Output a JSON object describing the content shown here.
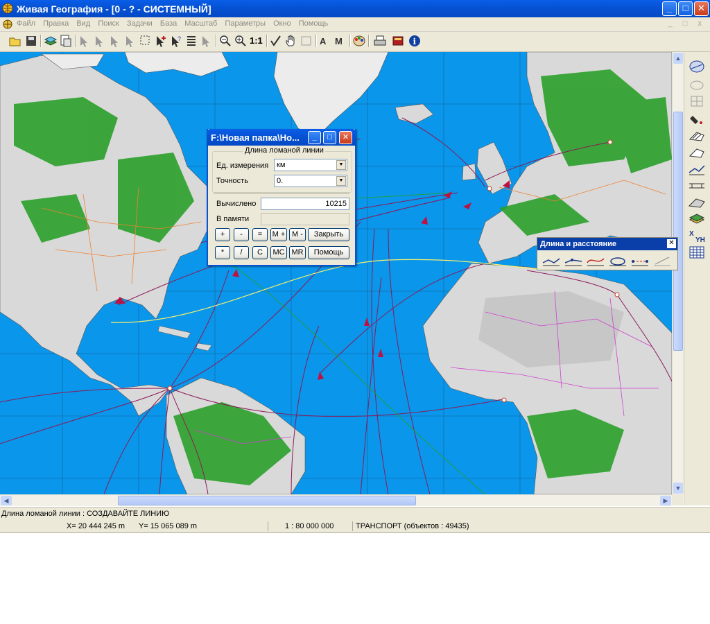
{
  "window": {
    "title": "Живая География - [0 -  ?  - СИСТЕМНЫЙ]",
    "minimize": "_",
    "maximize": "□",
    "close": "✕"
  },
  "menu": {
    "items": [
      "Файл",
      "Правка",
      "Вид",
      "Поиск",
      "Задачи",
      "База",
      "Масштаб",
      "Параметры",
      "Окно",
      "Помощь"
    ],
    "mdi_controls": "_ □ x"
  },
  "toolbar": {
    "zoom_ratio_label": "1:1",
    "icons": [
      "open-icon",
      "save-icon",
      "layers-icon",
      "print-preview-icon",
      "select-arrow-icon",
      "select-rect-icon",
      "list-icon",
      "zoom-out-icon",
      "zoom-in-icon",
      "pan-hand-icon",
      "text-icon",
      "palette-icon",
      "printer-icon",
      "book-icon",
      "info-icon"
    ]
  },
  "calculator_dialog": {
    "title": "F:\\Новая папка\\Но...",
    "group_title": "Длина ломаной линии",
    "units_label": "Ед. измерения",
    "units_value": "км",
    "precision_label": "Точность",
    "precision_value": "0.",
    "computed_label": "Вычислено",
    "computed_value": "10215",
    "memory_label": "В памяти",
    "memory_value": "",
    "buttons": {
      "plus": "+",
      "minus": "-",
      "equals": "=",
      "mplus": "M +",
      "mminus": "M -",
      "close": "Закрыть",
      "multiply": "*",
      "divide": "/",
      "clear": "C",
      "mc": "MC",
      "mr": "MR",
      "help": "Помощь"
    }
  },
  "length_palette": {
    "title": "Длина и расстояние",
    "close": "✕"
  },
  "status": {
    "message": "Длина ломаной линии : СОЗДАВАЙТЕ ЛИНИЮ",
    "x_coord": "X=  20 444 245 m",
    "y_coord": "Y=  15 065 089 m",
    "scale": "1 : 80 000 000",
    "layer_info": "ТРАНСПОРТ   (объектов : 49435)"
  },
  "colors": {
    "ocean": "#0a96ea",
    "land": "#d9d9d9",
    "vegetation": "#2aa02a",
    "title_bar": "#0653d6",
    "route_lines": "#8a1a5a"
  }
}
